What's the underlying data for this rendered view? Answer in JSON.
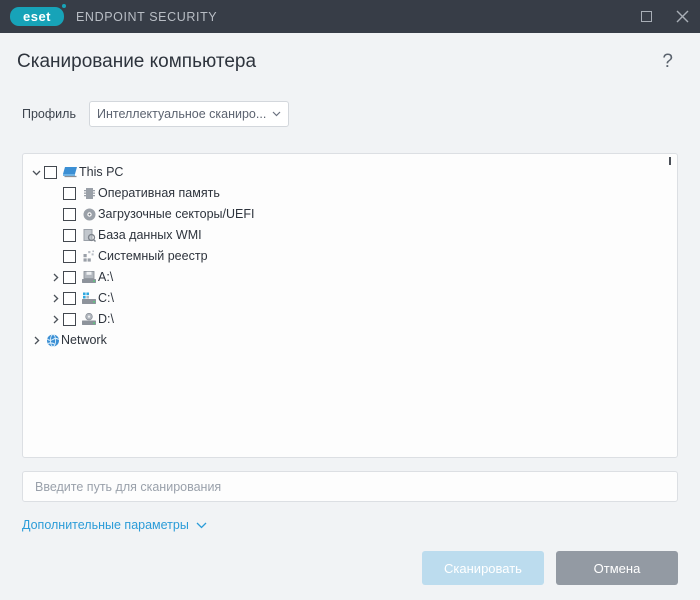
{
  "titlebar": {
    "logo_text": "eset",
    "product_name": "ENDPOINT SECURITY",
    "maximize_icon": "maximize-icon",
    "close_icon": "close-icon"
  },
  "header": {
    "title": "Сканирование компьютера",
    "help_icon": "?"
  },
  "profile": {
    "label": "Профиль",
    "selected": "Интеллектуальное сканиро...",
    "chevron_icon": "chevron-down-icon"
  },
  "tree": {
    "items": [
      {
        "label": "This PC",
        "indent": 0,
        "arrow": "down",
        "checkbox": true,
        "icon": "computer-icon"
      },
      {
        "label": "Оперативная память",
        "indent": 1,
        "arrow": "none",
        "checkbox": true,
        "icon": "memory-icon"
      },
      {
        "label": "Загрузочные секторы/UEFI",
        "indent": 1,
        "arrow": "none",
        "checkbox": true,
        "icon": "disc-icon"
      },
      {
        "label": "База данных WMI",
        "indent": 1,
        "arrow": "none",
        "checkbox": true,
        "icon": "wmi-icon"
      },
      {
        "label": "Системный реестр",
        "indent": 1,
        "arrow": "none",
        "checkbox": true,
        "icon": "registry-icon"
      },
      {
        "label": "A:\\",
        "indent": 1,
        "arrow": "right",
        "checkbox": true,
        "icon": "floppy-drive-icon"
      },
      {
        "label": "C:\\",
        "indent": 1,
        "arrow": "right",
        "checkbox": true,
        "icon": "hard-drive-icon"
      },
      {
        "label": "D:\\",
        "indent": 1,
        "arrow": "right",
        "checkbox": true,
        "icon": "optical-drive-icon"
      },
      {
        "label": "Network",
        "indent": 0,
        "arrow": "right",
        "checkbox": false,
        "icon": "network-globe-icon"
      }
    ]
  },
  "path_field": {
    "value": "",
    "placeholder": "Введите путь для сканирования"
  },
  "advanced": {
    "label": "Дополнительные параметры",
    "chevron_icon": "chevron-down-icon"
  },
  "footer": {
    "scan_label": "Сканировать",
    "cancel_label": "Отмена"
  },
  "colors": {
    "brand_teal": "#17a3b8",
    "titlebar": "#373d47",
    "body": "#f1f3f5",
    "link_blue": "#2b9cd8",
    "scan_button": "#bcdcee",
    "cancel_button": "#939aa3"
  }
}
